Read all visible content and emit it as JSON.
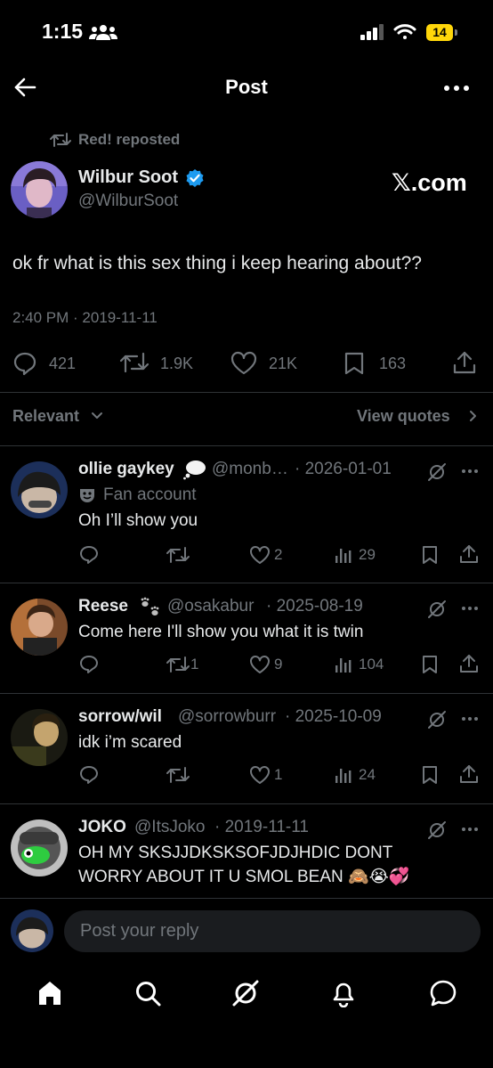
{
  "status_bar": {
    "time": "1:15",
    "battery": "14"
  },
  "header": {
    "title": "Post"
  },
  "post": {
    "repost_label": "Red! reposted",
    "author_name": "Wilbur Soot",
    "author_handle": "@WilburSoot",
    "source_label": "𝕏.com",
    "text": "ok fr what is this sex thing i keep hearing about??",
    "timestamp": "2:40 PM · 2019-11-11",
    "stats": {
      "replies": "421",
      "reposts": "1.9K",
      "likes": "21K",
      "bookmarks": "163"
    }
  },
  "sort": {
    "label": "Relevant",
    "view_quotes": "View quotes"
  },
  "replies": [
    {
      "name": "ollie gaykey",
      "handle": "@monb…",
      "date": "· 2026-01-01",
      "badge": "Fan account",
      "text": "Oh I’ll show you",
      "replies": "",
      "reposts": "",
      "likes": "2",
      "views": "29"
    },
    {
      "name": "Reese",
      "handle": "@osakabur",
      "date": "· 2025-08-19",
      "text": "Come here I'll show you what it is twin",
      "replies": "",
      "reposts": "1",
      "likes": "9",
      "views": "104"
    },
    {
      "name": "sorrow/wil",
      "handle": "@sorrowburr",
      "date": "· 2025-10-09",
      "text": "idk i’m scared",
      "replies": "",
      "reposts": "",
      "likes": "1",
      "views": "24"
    },
    {
      "name": "JOKO",
      "handle": "@ItsJoko",
      "date": "· 2019-11-11",
      "text_line1": "OH MY SKSJJDKSKSOFJDJHDIC DONT",
      "text_line2": "WORRY ABOUT IT U SMOL BEAN 🙈😭💞"
    }
  ],
  "composer": {
    "placeholder": "Post your reply"
  },
  "colors": {
    "background": "#000000",
    "text": "#e7e9ea",
    "muted": "#71767b",
    "verified": "#1d9bf0",
    "divider": "#2f3336"
  }
}
